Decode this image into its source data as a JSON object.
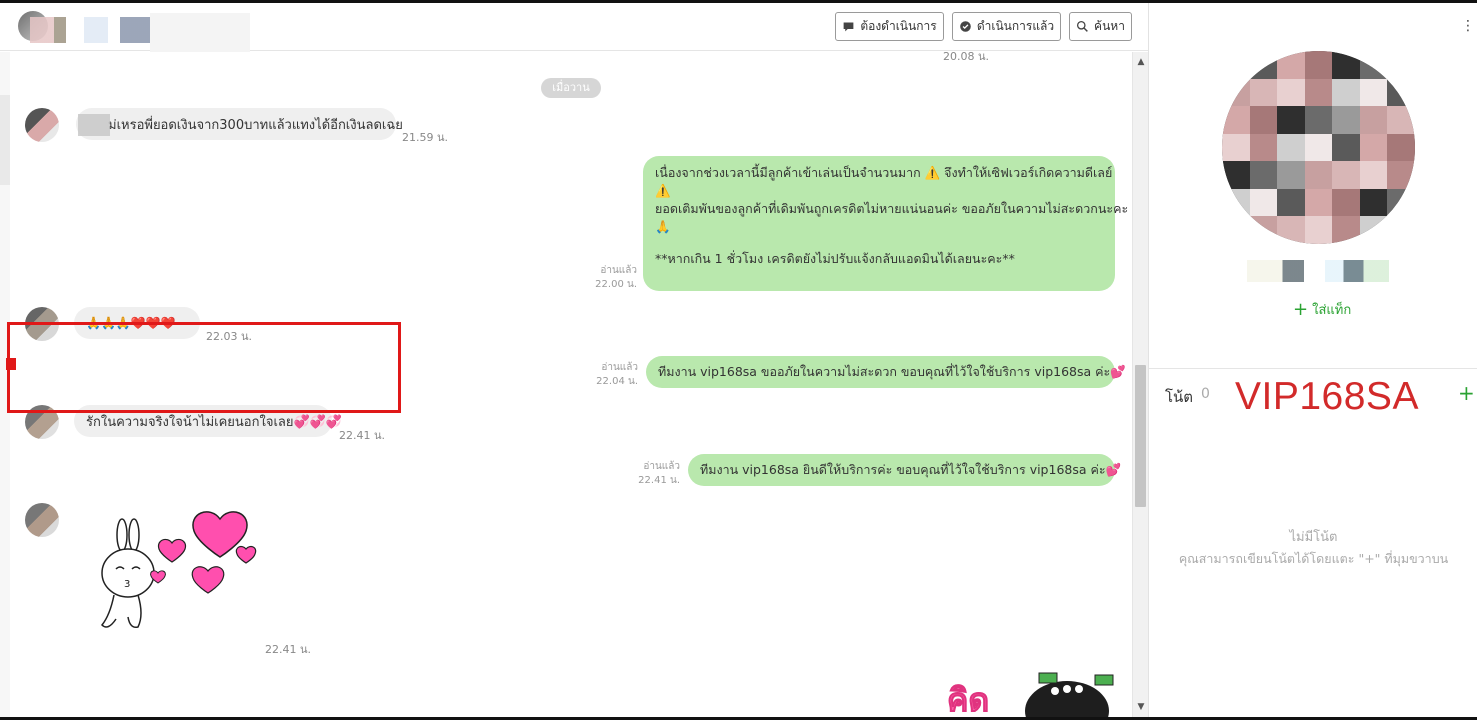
{
  "header": {
    "buttons": {
      "todo": "ต้องดำเนินการ",
      "done": "ดำเนินการแล้ว",
      "search": "ค้นหา"
    }
  },
  "chat": {
    "top_time": "20.08 น.",
    "date_separator": "เมื่อวาน",
    "messages": [
      {
        "id": "in1",
        "text": "ม่เหรอพี่ยอดเงินจาก300บาทแล้วแทงได้อีกเงินลดเฉย",
        "time": "21.59 น."
      },
      {
        "id": "out1",
        "lines": [
          "เนื่องจากช่วงเวลานี้มีลูกค้าเข้าเล่นเป็นจำนวนมาก ⚠️ จึงทำให้เซิฟเวอร์เกิดความดีเลย์",
          "⚠️",
          "ยอดเติมพันของลูกค้าที่เดิมพันถูกเครดิตไม่หายแน่นอนค่ะ ขออภัยในความไม่สะดวกนะคะ",
          "🙏",
          "",
          "**หากเกิน 1 ชั่วโมง เครดิตยังไม่ปรับแจ้งกลับแอดมินได้เลยนะคะ**"
        ],
        "read": "อ่านแล้ว",
        "time": "22.00 น."
      },
      {
        "id": "in2",
        "text": "🙏🙏🙏❤️❤️❤️",
        "time": "22.03 น."
      },
      {
        "id": "out2",
        "text": "ทีมงาน vip168sa ขออภัยในความไม่สะดวก ขอบคุณที่ไว้ใจใช้บริการ vip168sa ค่ะ💕",
        "read": "อ่านแล้ว",
        "time": "22.04 น."
      },
      {
        "id": "in3",
        "text": "รักในความจริงใจน้าไม่เคยนอกใจเลย💞💞💞",
        "time": "22.41 น."
      },
      {
        "id": "out3",
        "text": "ทีมงาน vip168sa ยินดีให้บริการค่ะ ขอบคุณที่ไว้ใจใช้บริการ vip168sa ค่ะ💕",
        "read": "อ่านแล้ว",
        "time": "22.41 น."
      },
      {
        "id": "in4",
        "time": "22.41 น."
      }
    ],
    "bottom_sticker_text": "คิด"
  },
  "panel": {
    "kebab": "⋮",
    "add_tag": "ใส่แท็ก",
    "note_label": "โน้ต",
    "note_count": "0",
    "vip_label": "VIP168SA",
    "note_add": "+",
    "no_note_title": "ไม่มีโน้ต",
    "no_note_desc": "คุณสามารถเขียนโน้ตได้โดยแตะ \"+\" ที่มุมขวาบน"
  },
  "colors": {
    "bubble_out": "#b9e8ad",
    "bubble_in": "#efefef",
    "accent_green": "#2aa232",
    "vip_red": "#d22a2a",
    "highlight_red": "#e01818"
  }
}
